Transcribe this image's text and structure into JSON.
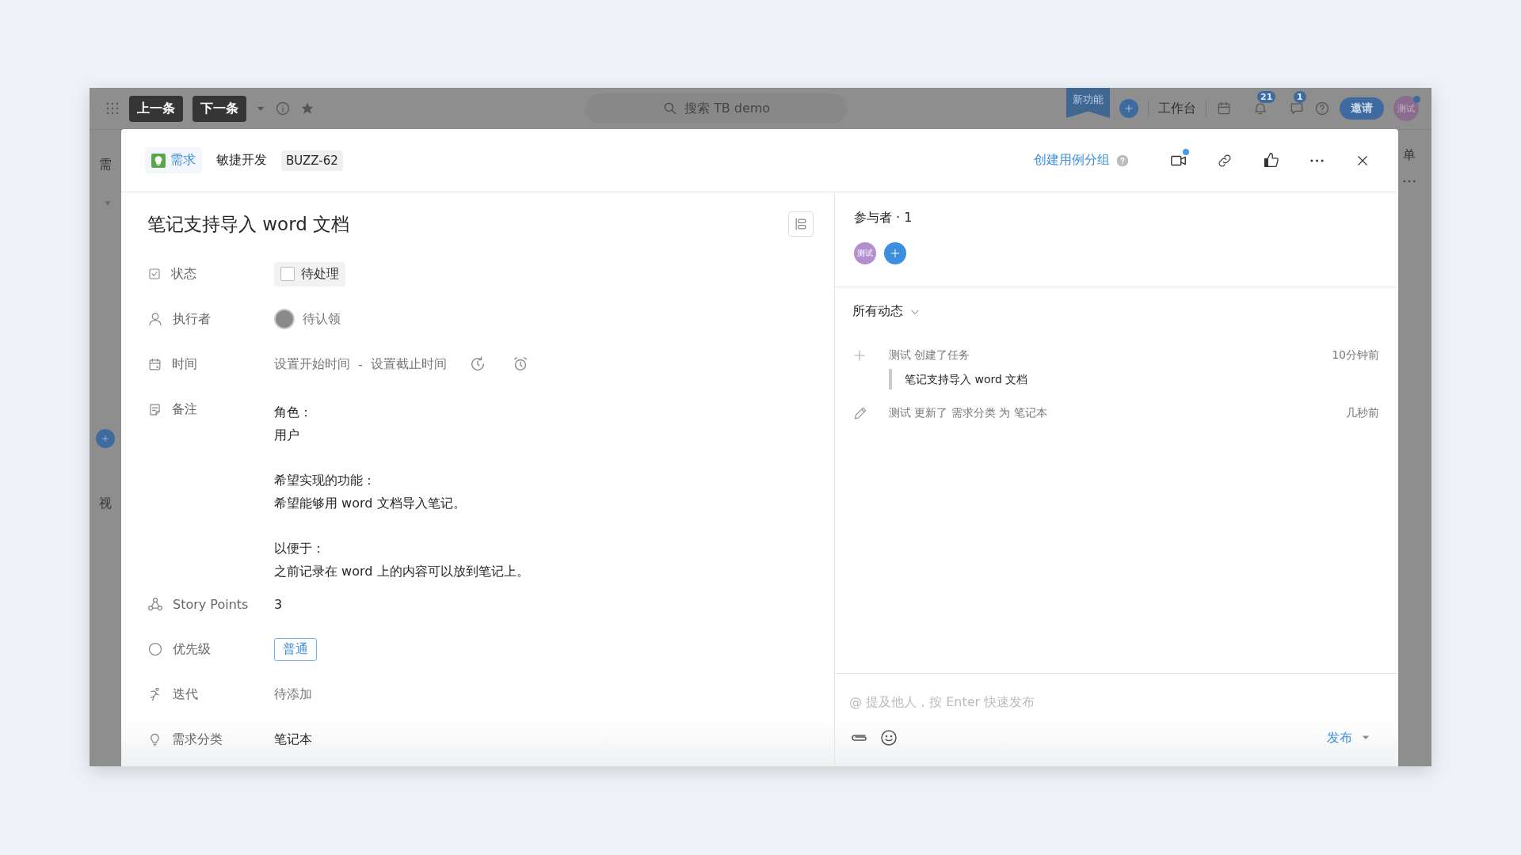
{
  "app_bar": {
    "nav_buttons": [
      "上一条",
      "下一条"
    ],
    "search": {
      "placeholder": "搜索 TB demo"
    },
    "new_feature": "新功能",
    "workbench": "工作台",
    "notifications": [
      {
        "kind": "bell",
        "count": "21"
      },
      {
        "kind": "chat",
        "count": "1"
      }
    ],
    "invite": "邀请",
    "avatar": "测试"
  },
  "background": {
    "left_labels": [
      "需",
      "视"
    ],
    "right_label": "单"
  },
  "modal": {
    "type_tag": "需求",
    "project": "敏捷开发",
    "id": "BUZZ-62",
    "create_group": "创建用例分组",
    "title": "笔记支持导入 word 文档",
    "fields": [
      {
        "kind": "status",
        "label": "状态",
        "value": "待处理",
        "checked": false
      },
      {
        "kind": "assignee",
        "label": "执行者",
        "value": "待认领"
      },
      {
        "kind": "time",
        "label": "时间",
        "start": "设置开始时间",
        "separator": "-",
        "end": "设置截止时间"
      },
      {
        "kind": "note",
        "label": "备注",
        "paragraphs": [
          [
            "角色：",
            "用户"
          ],
          [
            "希望实现的功能：",
            "希望能够用 word 文档导入笔记。"
          ],
          [
            "以便于：",
            "之前记录在 word 上的内容可以放到笔记上。"
          ]
        ]
      },
      {
        "kind": "text",
        "label": "Story Points",
        "value": "3"
      },
      {
        "kind": "tag",
        "label": "优先级",
        "value": "普通"
      },
      {
        "kind": "empty",
        "label": "迭代",
        "placeholder": "待添加"
      },
      {
        "kind": "text",
        "label": "需求分类",
        "value": "笔记本"
      }
    ],
    "participants": {
      "title": "参与者 · 1",
      "avatars": [
        "测试"
      ]
    },
    "activity": {
      "filter": "所有动态",
      "items": [
        {
          "kind": "create",
          "text": "测试 创建了任务",
          "time": "10分钟前",
          "quote": "笔记支持导入 word 文档"
        },
        {
          "kind": "update",
          "text": "测试 更新了 需求分类 为 笔记本",
          "time": "几秒前"
        }
      ]
    },
    "comment": {
      "placeholder": "@ 提及他人，按 Enter 快速发布",
      "publish": "发布"
    }
  }
}
